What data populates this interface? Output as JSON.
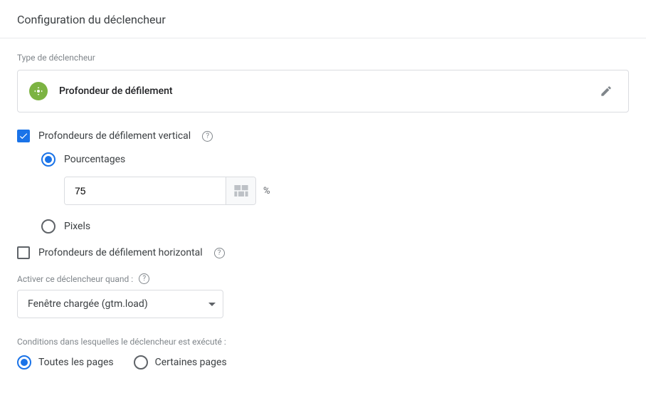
{
  "header": {
    "title": "Configuration du déclencheur"
  },
  "triggerType": {
    "label": "Type de déclencheur",
    "name": "Profondeur de défilement"
  },
  "verticalScroll": {
    "checkboxLabel": "Profondeurs de défilement vertical",
    "percentages": {
      "label": "Pourcentages",
      "value": "75",
      "unit": "%"
    },
    "pixels": {
      "label": "Pixels"
    }
  },
  "horizontalScroll": {
    "checkboxLabel": "Profondeurs de défilement horizontal"
  },
  "activate": {
    "label": "Activer ce déclencheur quand :",
    "selected": "Fenêtre chargée (gtm.load)"
  },
  "conditions": {
    "label": "Conditions dans lesquelles le déclencheur est exécuté :",
    "allPages": "Toutes les pages",
    "somePages": "Certaines pages"
  }
}
